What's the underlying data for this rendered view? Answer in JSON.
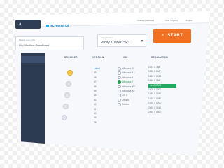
{
  "header": {
    "back_label": "",
    "logo_text": "screenshot",
    "links": [
      "Change password",
      "Chat Support",
      "Logout"
    ]
  },
  "sidebar": {
    "items": [
      "",
      "",
      "",
      ""
    ]
  },
  "url_field": {
    "label": "Please enter URL",
    "value": "http://loalbox.Dashboard"
  },
  "select": {
    "label": "Proxy Tunnel",
    "value": "Proxy Tunnel: SP3"
  },
  "start_button": {
    "label": "START"
  },
  "table": {
    "headers": [
      "BROWSER",
      "VERSION",
      "OS",
      "RESOLUTION"
    ],
    "versions": [
      "Latest",
      "49",
      "48",
      "47",
      "46",
      "45",
      "44",
      "43",
      "42",
      "41",
      "40",
      "39",
      "38"
    ],
    "os": [
      "Windows 10",
      "Windows 8.1",
      "Windows 8",
      "Windows 7",
      "Windows XP",
      "Windows XP",
      "OS X",
      "Ubuntu",
      "Debian"
    ],
    "resolutions": [
      "1024 X 768",
      "1280 X 800",
      "1280 X 1024",
      "1366 X 768",
      "1440 X 900",
      "1600 X 1200",
      "1680 X 1050",
      "1920 X 1080",
      "1920 X 1200",
      "2560 X 1440",
      "2560 X 1600"
    ]
  },
  "colors": {
    "accent_orange": "#f27022",
    "sidebar_navy": "#2d3b52",
    "selected_green": "#22a861",
    "link_blue": "#1c89d8"
  }
}
